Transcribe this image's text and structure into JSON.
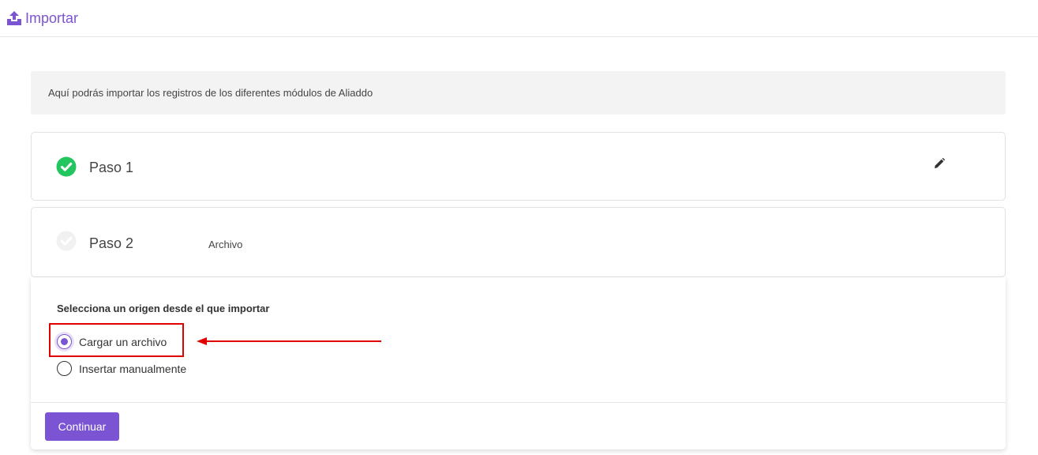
{
  "header": {
    "title": "Importar",
    "icon": "upload-icon",
    "accent_color": "#7b54d3"
  },
  "info": {
    "text": "Aquí podrás importar los registros de los diferentes módulos de Aliaddo"
  },
  "steps": [
    {
      "label": "Paso 1",
      "status": "completed",
      "icon": "check-circle-icon",
      "status_color": "#22c55e",
      "editable": true,
      "edit_icon": "pencil-icon"
    },
    {
      "label": "Paso 2",
      "status": "current",
      "icon": "check-circle-icon",
      "sublabel": "Archivo"
    }
  ],
  "panel": {
    "question": "Selecciona un origen desde el que importar",
    "options": [
      {
        "label": "Cargar un archivo",
        "checked": true
      },
      {
        "label": "Insertar manualmente",
        "checked": false
      }
    ],
    "continue_label": "Continuar"
  },
  "annotation": {
    "highlight_color": "#e00000",
    "arrow_target": "Cargar un archivo"
  }
}
